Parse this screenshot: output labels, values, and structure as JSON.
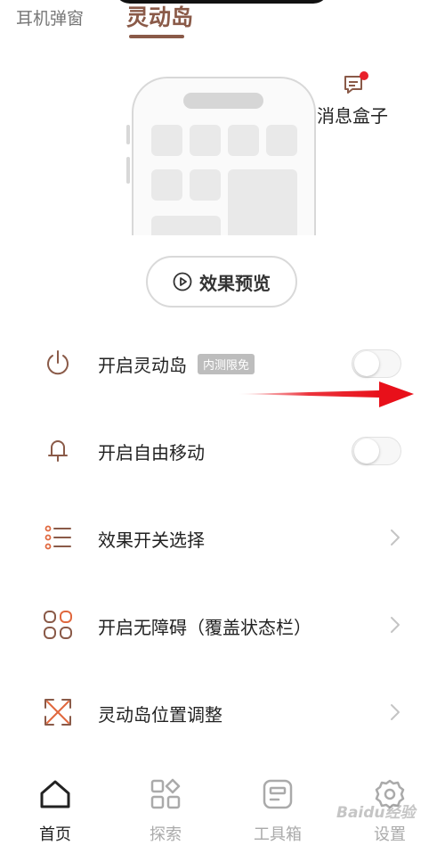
{
  "tabs": [
    {
      "label": "耳机弹窗",
      "active": false
    },
    {
      "label": "灵动岛",
      "active": true
    }
  ],
  "message_box": {
    "label": "消息盒子",
    "has_notification": true
  },
  "preview_button": {
    "label": "效果预览"
  },
  "settings": [
    {
      "label": "开启灵动岛",
      "badge": "内测限免",
      "control": "toggle",
      "on": false,
      "icon": "power-icon"
    },
    {
      "label": "开启自由移动",
      "control": "toggle",
      "on": false,
      "icon": "bell-icon"
    },
    {
      "label": "效果开关选择",
      "control": "chevron",
      "icon": "list-icon"
    },
    {
      "label": "开启无障碍（覆盖状态栏）",
      "control": "chevron",
      "icon": "apps-grid-icon"
    },
    {
      "label": "灵动岛位置调整",
      "control": "chevron",
      "icon": "expand-arrows-icon"
    }
  ],
  "bottom_nav": [
    {
      "label": "首页",
      "icon": "home-icon",
      "active": true
    },
    {
      "label": "探索",
      "icon": "explore-icon",
      "active": false
    },
    {
      "label": "工具箱",
      "icon": "toolbox-icon",
      "active": false
    },
    {
      "label": "设置",
      "icon": "gear-icon",
      "active": false
    }
  ],
  "watermark": "Baidu经验",
  "colors": {
    "accent": "#8a5a48",
    "icon_orange": "#e0683e",
    "notification_dot": "#e8202a",
    "annotation_arrow": "#e8101a"
  }
}
